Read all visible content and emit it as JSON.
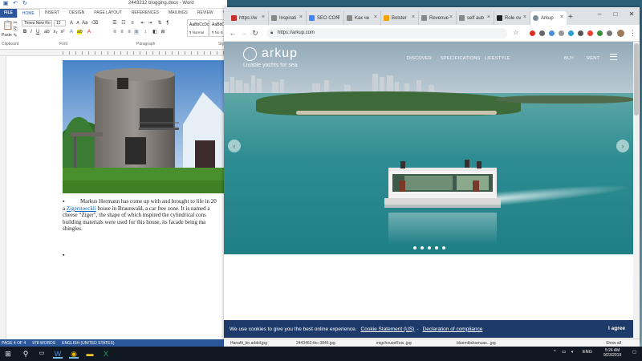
{
  "word": {
    "doc_title": "2443212 blogging.docx - Word",
    "tabs": [
      "FILE",
      "HOME",
      "INSERT",
      "DESIGN",
      "PAGE LAYOUT",
      "REFERENCES",
      "MAILINGS",
      "REVIEW",
      "VIEW"
    ],
    "active_tab": "HOME",
    "font_name": "Times New Ro",
    "font_size": "12",
    "paste_label": "Paste",
    "group_labels": [
      "Clipboard",
      "Font",
      "Paragraph",
      "Sty"
    ],
    "styles": [
      {
        "preview": "AaBbCcDc",
        "label": "¶ Normal"
      },
      {
        "preview": "AaBbCcDc",
        "label": "¶ No S"
      }
    ],
    "paragraph_lines": [
      "Markus Hermann has come up with and brought to life in 20",
      "house in Braunwald, a car free zone. It is named a",
      "cheese “Ziger”, the shape of which inspired the cylindrical cons",
      "building materials were used for this house, its facade being ma",
      "shingles."
    ],
    "para_line2_prefix": "a ",
    "link_text": "Zigerstoeckli",
    "bullet": "▪",
    "status": [
      "PAGE 4 OF 4",
      "978 WORDS",
      "ENGLISH (UNITED STATES)"
    ]
  },
  "chrome": {
    "tabs": [
      {
        "title": "https://w",
        "color": "#c4302b",
        "active": false
      },
      {
        "title": "Inspirati",
        "color": "#888888",
        "active": false
      },
      {
        "title": "SEO CON",
        "color": "#4285f4",
        "active": false
      },
      {
        "title": "Kaк че",
        "color": "#888888",
        "active": false
      },
      {
        "title": "Bolster",
        "color": "#f4a300",
        "active": false
      },
      {
        "title": "Revenue",
        "color": "#888888",
        "active": false
      },
      {
        "title": "self aub",
        "color": "#888888",
        "active": false
      },
      {
        "title": "Role ov",
        "color": "#222222",
        "active": false
      },
      {
        "title": "Arkup",
        "color": "#7a8c99",
        "active": true
      }
    ],
    "url": "https://arkup.com",
    "new_tab_symbol": "+",
    "minimize": "–",
    "maximize": "□",
    "close": "✕"
  },
  "site": {
    "brand": "arkup",
    "tagline": "Livable yachts for sea",
    "nav": [
      "Discover",
      "Specifications",
      "Lifestyle",
      "Buy",
      "Rent"
    ],
    "slide_count": 5,
    "cookie_text": "We use cookies to give you the best online experience.",
    "cookie_link1": "Cookie Statement (US)",
    "cookie_link2": "Declaration of compliance",
    "cookie_agree": "I agree"
  },
  "downloads": [
    "Hanafit_bn.arbbil.jpg",
    "2443462-thc-3845.jpg",
    "imgchouseRois..jpg",
    "bluemtbckamuas...jpg"
  ],
  "downloads_show_all": "Show all",
  "taskbar": {
    "language": "ENG",
    "time": "5:24 AM",
    "date": "9/23/2019"
  },
  "colors": {
    "word_blue": "#2b579a",
    "cookie_bg": "#1d3a6a",
    "taskbar_bg": "#101822"
  }
}
